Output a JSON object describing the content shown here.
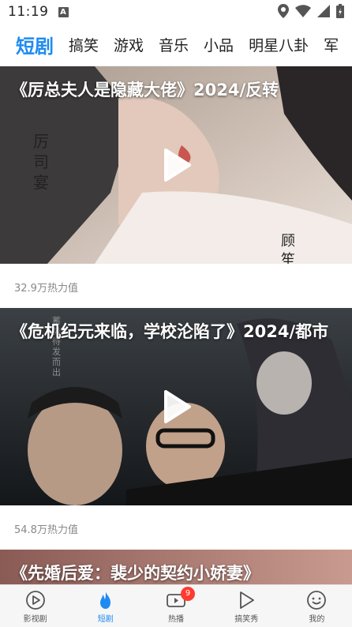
{
  "status_bar": {
    "time": "11:19",
    "notification_letter": "A"
  },
  "tabs": [
    {
      "label": "短剧",
      "active": true
    },
    {
      "label": "搞笑",
      "active": false
    },
    {
      "label": "游戏",
      "active": false
    },
    {
      "label": "音乐",
      "active": false
    },
    {
      "label": "小品",
      "active": false
    },
    {
      "label": "明星八卦",
      "active": false
    },
    {
      "label": "军",
      "active": false
    }
  ],
  "feed": [
    {
      "title": "《厉总夫人是隐藏大佬》2024/反转",
      "heat": "32.9万热力值",
      "poster_text_left": "厉司宴",
      "poster_text_right": "顾笙"
    },
    {
      "title": "《危机纪元来临，学校沦陷了》2024/都市",
      "heat": "54.8万热力值",
      "poster_text_left": "蓄势待发而出"
    },
    {
      "title": "《先婚后爱：裴少的契约小娇妻》"
    }
  ],
  "bottom_nav": [
    {
      "label": "影视剧",
      "icon": "play-circle-icon",
      "active": false
    },
    {
      "label": "短剧",
      "icon": "flame-icon",
      "active": true
    },
    {
      "label": "热播",
      "icon": "video-camera-icon",
      "active": false,
      "badge": "9"
    },
    {
      "label": "搞笑秀",
      "icon": "play-triangle-icon",
      "active": false
    },
    {
      "label": "我的",
      "icon": "smiley-icon",
      "active": false
    }
  ],
  "colors": {
    "accent": "#1f8bf1",
    "badge": "#ff3b30"
  }
}
